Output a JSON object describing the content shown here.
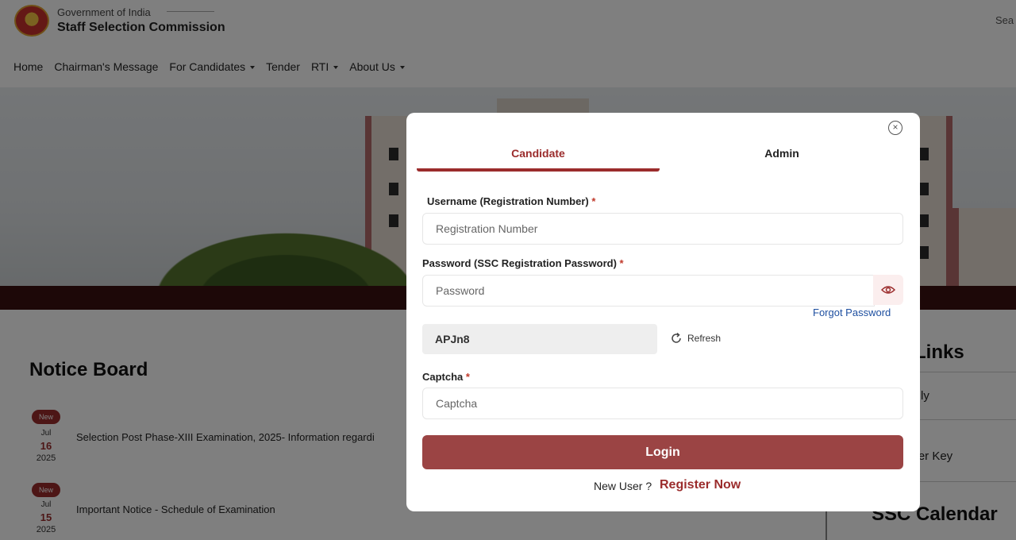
{
  "header": {
    "gov_label": "Government of India",
    "org_name": "Staff Selection Commission",
    "search_partial": "Sea"
  },
  "nav": {
    "home": "Home",
    "chairman": "Chairman's Message",
    "candidates": "For Candidates",
    "tender": "Tender",
    "rti": "RTI",
    "about": "About Us"
  },
  "notice_board": {
    "title": "Notice Board",
    "items": [
      {
        "badge": "New",
        "month": "Jul",
        "day": "16",
        "year": "2025",
        "text": "Selection Post Phase-XIII Examination, 2025- Information regardi"
      },
      {
        "badge": "New",
        "month": "Jul",
        "day": "15",
        "year": "2025",
        "text": "Important Notice - Schedule of Examination"
      }
    ]
  },
  "right_panel": {
    "heading_partial": "Links",
    "link1_partial": "ly",
    "link2_partial": "wer Key",
    "calendar": "SSC Calendar"
  },
  "modal": {
    "tabs": {
      "candidate": "Candidate",
      "admin": "Admin"
    },
    "username_label": "Username (Registration Number)",
    "username_placeholder": "Registration Number",
    "password_label": "Password (SSC Registration Password)",
    "password_placeholder": "Password",
    "required_mark": "*",
    "forgot": "Forgot Password",
    "captcha_code": "APJn8",
    "refresh": "Refresh",
    "captcha_label": "Captcha",
    "captcha_placeholder": "Captcha",
    "login": "Login",
    "new_user": "New User ?",
    "register": "Register Now",
    "close_symbol": "×"
  },
  "colors": {
    "accent": "#9b2c2c",
    "login_button": "#9b4444",
    "link": "#1e4fa0"
  }
}
